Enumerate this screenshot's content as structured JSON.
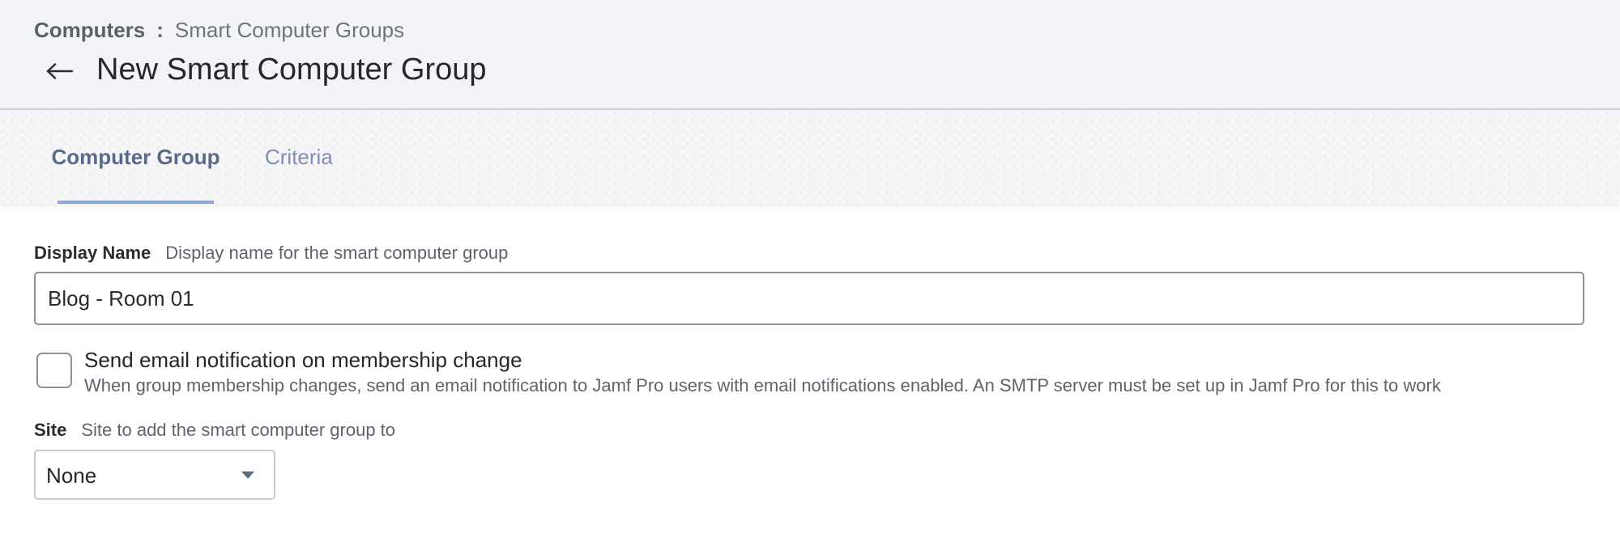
{
  "breadcrumb": {
    "parent": "Computers",
    "separator": ":",
    "current": "Smart Computer Groups"
  },
  "header": {
    "back_icon": "arrow-left-icon",
    "title": "New Smart Computer Group"
  },
  "tabs": [
    {
      "label": "Computer Group",
      "active": true
    },
    {
      "label": "Criteria",
      "active": false
    }
  ],
  "display_name": {
    "label": "Display Name",
    "description": "Display name for the smart computer group",
    "value": "Blog - Room 01"
  },
  "email_notification": {
    "checked": false,
    "label": "Send email notification on membership change",
    "description": "When group membership changes, send an email notification to Jamf Pro users with email notifications enabled. An SMTP server must be set up in Jamf Pro for this to work"
  },
  "site": {
    "label": "Site",
    "description": "Site to add the smart computer group to",
    "selected": "None",
    "caret_icon": "caret-down-icon"
  },
  "colors": {
    "header_bg": "#f3f4f7",
    "tab_active_text": "#5a6a8a",
    "tab_inactive_text": "#7d8fb4",
    "tab_underline": "#8fa6d3"
  }
}
